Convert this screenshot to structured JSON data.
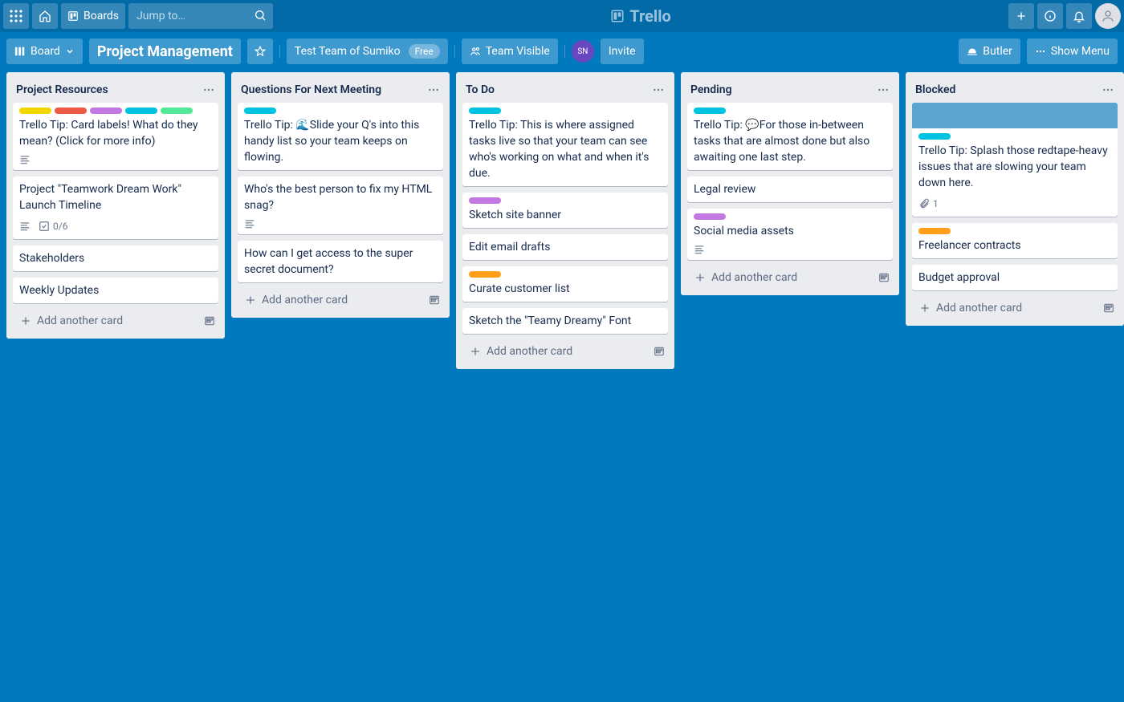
{
  "topbar": {
    "apps_title": "Apps",
    "home_title": "Home",
    "boards_label": "Boards",
    "search_placeholder": "Jump to…",
    "brand": "Trello",
    "create": "Create",
    "info": "Info",
    "notifications": "Notifications"
  },
  "board_header": {
    "board_button": "Board",
    "title": "Project Management",
    "team": "Test Team of Sumiko",
    "free": "Free",
    "visibility": "Team Visible",
    "member_initials": "SN",
    "invite": "Invite",
    "butler": "Butler",
    "show_menu": "Show Menu"
  },
  "lists": [
    {
      "title": "Project Resources",
      "cards": [
        {
          "labels": [
            "#f2d600",
            "#eb5a46",
            "#c377e0",
            "#00c2e0",
            "#51e898"
          ],
          "text": "Trello Tip: Card labels! What do they mean? (Click for more info)",
          "desc": true
        },
        {
          "text": "Project \"Teamwork Dream Work\" Launch Timeline",
          "desc": true,
          "checklist": "0/6"
        },
        {
          "text": "Stakeholders"
        },
        {
          "text": "Weekly Updates"
        }
      ],
      "add": "Add another card"
    },
    {
      "title": "Questions For Next Meeting",
      "cards": [
        {
          "labels": [
            "#00c2e0"
          ],
          "text": "Trello Tip: 🌊Slide your Q's into this handy list so your team keeps on flowing."
        },
        {
          "text": "Who's the best person to fix my HTML snag?",
          "desc": true
        },
        {
          "text": "How can I get access to the super secret document?"
        }
      ],
      "add": "Add another card"
    },
    {
      "title": "To Do",
      "cards": [
        {
          "labels": [
            "#00c2e0"
          ],
          "text": "Trello Tip: This is where assigned tasks live so that your team can see who's working on what and when it's due."
        },
        {
          "labels": [
            "#c377e0"
          ],
          "text": "Sketch site banner"
        },
        {
          "text": "Edit email drafts"
        },
        {
          "labels": [
            "#ff9f1a"
          ],
          "text": "Curate customer list"
        },
        {
          "text": "Sketch the \"Teamy Dreamy\" Font"
        }
      ],
      "add": "Add another card"
    },
    {
      "title": "Pending",
      "cards": [
        {
          "labels": [
            "#00c2e0"
          ],
          "text": "Trello Tip: 💬For those in-between tasks that are almost done but also awaiting one last step."
        },
        {
          "text": "Legal review"
        },
        {
          "labels": [
            "#c377e0"
          ],
          "text": "Social media assets",
          "desc": true
        }
      ],
      "add": "Add another card"
    },
    {
      "title": "Blocked",
      "cards": [
        {
          "cover": true,
          "labels": [
            "#00c2e0"
          ],
          "text": "Trello Tip: Splash those redtape-heavy issues that are slowing your team down here.",
          "attachments": "1"
        },
        {
          "labels": [
            "#ff9f1a"
          ],
          "text": "Freelancer contracts"
        },
        {
          "text": "Budget approval"
        }
      ],
      "add": "Add another card"
    }
  ]
}
